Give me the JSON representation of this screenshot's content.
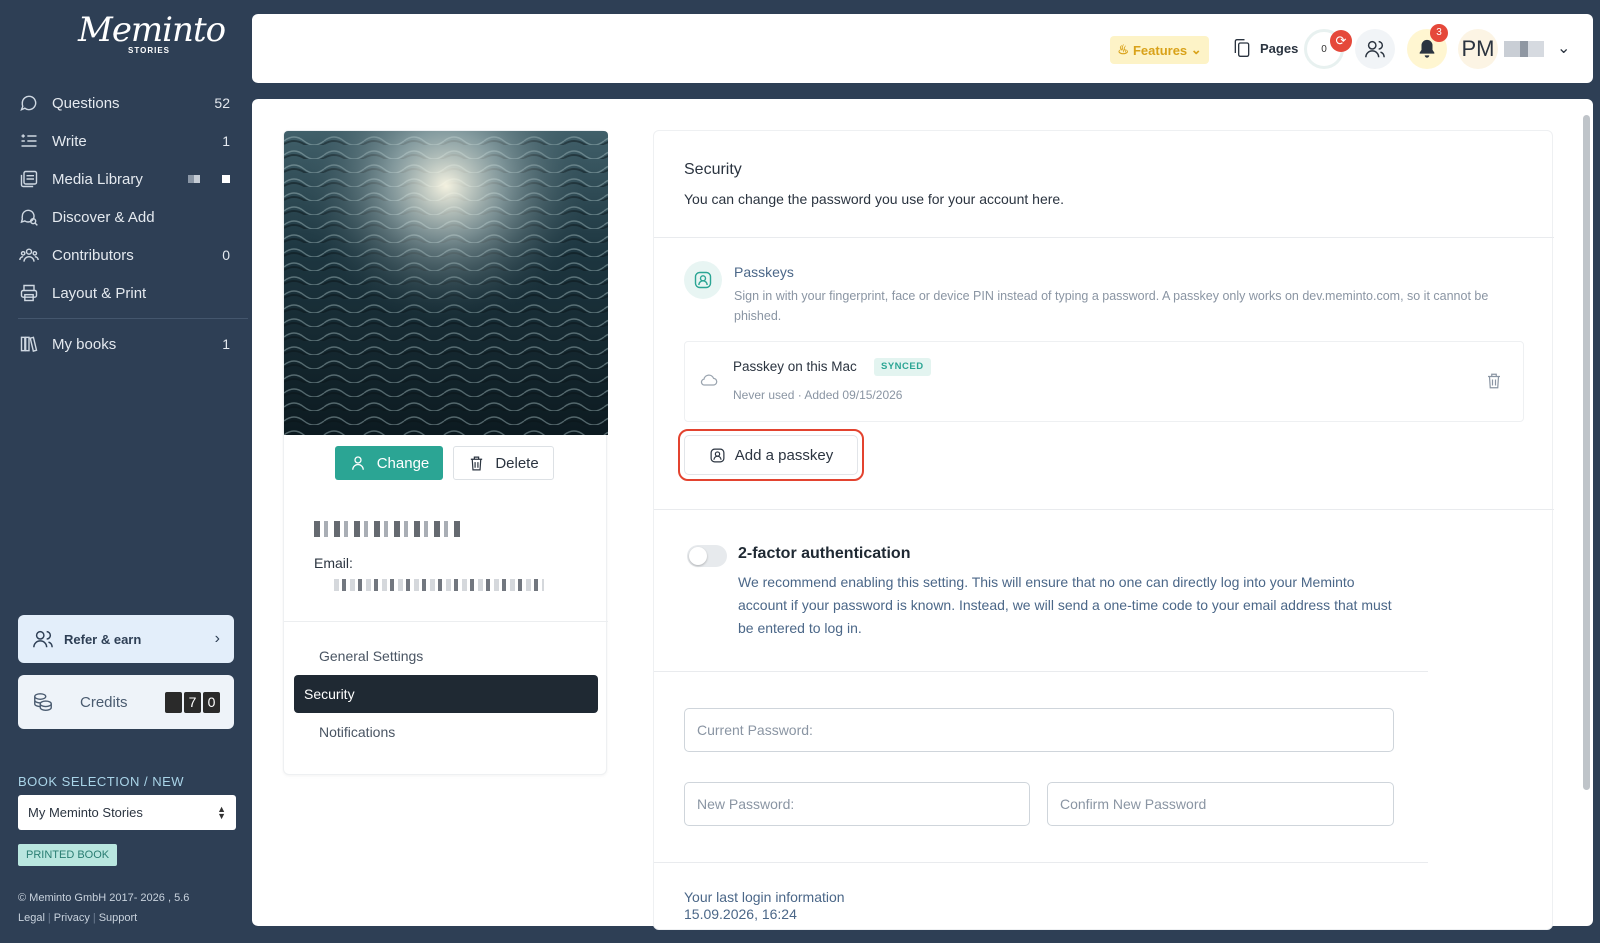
{
  "logo": {
    "script": "Meminto",
    "sub": "STORIES"
  },
  "sidebar": {
    "items": [
      {
        "label": "Questions",
        "count": "52",
        "icon": "chat-question-icon"
      },
      {
        "label": "Write",
        "count": "1",
        "icon": "write-icon"
      },
      {
        "label": "Media Library",
        "count": "",
        "icon": "media-library-icon"
      },
      {
        "label": "Discover & Add",
        "count": "",
        "icon": "discover-icon"
      },
      {
        "label": "Contributors",
        "count": "0",
        "icon": "contributors-icon"
      },
      {
        "label": "Layout & Print",
        "count": "",
        "icon": "print-icon"
      }
    ],
    "mybooks": {
      "label": "My books",
      "count": "1"
    },
    "refer": {
      "label": "Refer & earn"
    },
    "credits": {
      "label": "Credits",
      "digits": [
        "",
        "7",
        "0"
      ]
    },
    "book_selection_title": "BOOK SELECTION / NEW",
    "book_select_value": "My Meminto Stories",
    "printed_badge": "PRINTED BOOK",
    "copyright": "© Meminto GmbH 2017- 2026 , 5.6",
    "links": [
      "Legal",
      "Privacy",
      "Support"
    ]
  },
  "topbar": {
    "features_label": "Features",
    "pages_label": "Pages",
    "counter": "0",
    "notifications": "3",
    "avatar_initials": "PM"
  },
  "profile": {
    "change_label": "Change",
    "delete_label": "Delete",
    "email_label": "Email:",
    "menu": [
      {
        "label": "General Settings",
        "active": false
      },
      {
        "label": "Security",
        "active": true
      },
      {
        "label": "Notifications",
        "active": false
      }
    ]
  },
  "security": {
    "title": "Security",
    "subtitle": "You can change the password you use for your account here.",
    "passkeys": {
      "title": "Passkeys",
      "description": "Sign in with your fingerprint, face or device PIN instead of typing a password. A passkey only works on dev.meminto.com, so it cannot be phished.",
      "entry": {
        "name": "Passkey on this Mac",
        "badge": "SYNCED",
        "meta": "Never used · Added 09/15/2026"
      },
      "add_label": "Add a passkey"
    },
    "two_factor": {
      "title": "2-factor authentication",
      "enabled": false,
      "description": "We recommend enabling this setting. This will ensure that no one can directly log into your Meminto account if your password is known. Instead, we will send a one-time code to your email address that must be entered to log in."
    },
    "fields": {
      "current_placeholder": "Current Password:",
      "new_placeholder": "New Password:",
      "confirm_placeholder": "Confirm New Password"
    },
    "last_login": {
      "label": "Your last login information",
      "value": "15.09.2026, 16:24"
    }
  },
  "colors": {
    "sidebar": "#2e3f55",
    "accent": "#2ba594",
    "highlight": "#e3432f",
    "features": "#d9a21a"
  }
}
